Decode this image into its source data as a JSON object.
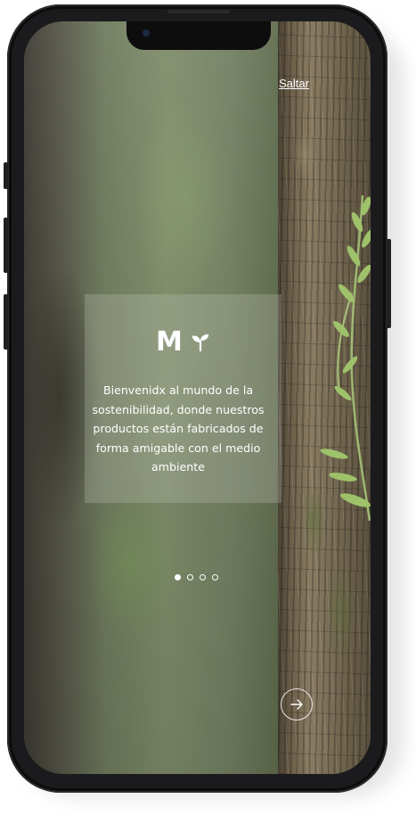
{
  "header": {
    "skip_label": "Saltar"
  },
  "onboarding": {
    "brand_letter": "M",
    "brand_icon": "sprout-icon",
    "message": "Bienvenidx al mundo de la sostenibilidad, donde nuestros productos están fabricados de forma amigable con el medio ambiente",
    "page_indicator": {
      "current": 1,
      "total": 4
    },
    "next_icon": "arrow-right-icon"
  },
  "colors": {
    "text": "#ffffff",
    "card_overlay": "rgba(210,210,200,0.24)",
    "device_frame": "#1b1b1d"
  }
}
